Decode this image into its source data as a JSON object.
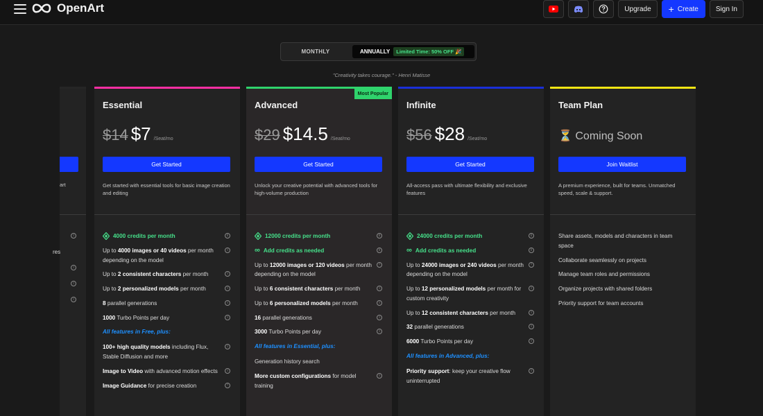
{
  "header": {
    "brand": "OpenArt",
    "buttons": {
      "upgrade": "Upgrade",
      "create": "Create",
      "signin": "Sign In"
    }
  },
  "billing": {
    "monthly": "MONTHLY",
    "annually": "ANNUALLY",
    "promo": "Limited Time: 50% OFF 🎉"
  },
  "quote": "\"Creativity takes courage.\" - Henri Matisse",
  "partial_card": {
    "desc_frag": "art",
    "feat_frag": "res"
  },
  "plans": [
    {
      "name": "Essential",
      "old_price": "$14",
      "new_price": "$7",
      "unit": "/Seat/mo",
      "cta": "Get Started",
      "accent": "#ff2fa3",
      "desc": "Get started with essential tools for basic image creation and editing",
      "credits": "4000 credits per month",
      "f1_b": "4000 images or 40 videos",
      "f1_t": "month depending on the model",
      "f2_b": "2 consistent characters",
      "f2_t": "per month",
      "f3_b": "2 personalized models",
      "f3_t": "per month",
      "f4_b": "8",
      "f4_t": "parallel generations",
      "f5_b": "1000",
      "f5_t": "Turbo Points per day",
      "section": "All features in Free, plus:",
      "e1_b": "100+ high quality models",
      "e1_t": "including Flux, Stable Diffusion and more",
      "e2_b": "Image to Video",
      "e2_t": "with advanced motion effects",
      "e3_b": "Image Guidance",
      "e3_t": "for precise creation"
    },
    {
      "name": "Advanced",
      "old_price": "$29",
      "new_price": "$14.5",
      "unit": "/Seat/mo",
      "cta": "Get Started",
      "badge": "Most Popular",
      "accent": "#2fd36c",
      "desc": "Unlock your creative potential with advanced tools for high-volume production",
      "credits": "12000 credits per month",
      "addon": "Add credits as needed",
      "f1_b": "12000 images or 120 videos",
      "f1_t": "per month depending on the model",
      "f2_b": "6 consistent characters",
      "f2_t": "per month",
      "f3_b": "6 personalized models",
      "f3_t": "per month",
      "f4_b": "16",
      "f4_t": "parallel generations",
      "f5_b": "3000",
      "f5_t": "Turbo Points per day",
      "section": "All features in Essential, plus:",
      "e1_t": "Generation history search",
      "e2_b": "More custom configurations",
      "e2_t": "for model training"
    },
    {
      "name": "Infinite",
      "old_price": "$56",
      "new_price": "$28",
      "unit": "/Seat/mo",
      "cta": "Get Started",
      "accent": "#1a2fd8",
      "desc": "All-access pass with ultimate flexibility and exclusive features",
      "credits": "24000 credits per month",
      "addon": "Add credits as needed",
      "f1_b": "24000 images or 240 videos",
      "f1_t": "per month depending on the model",
      "f2_b": "12 personalized models",
      "f2_t": "per month for custom creativity",
      "f3_b": "12 consistent characters",
      "f3_t": "per month",
      "f4_b": "32",
      "f4_t": "parallel generations",
      "f5_b": "6000",
      "f5_t": "Turbo Points per day",
      "section": "All features in Advanced, plus:",
      "e1_b": "Priority support",
      "e1_t": ": keep your creative flow uninterrupted"
    },
    {
      "name": "Team Plan",
      "soon": "⏳ Coming Soon",
      "cta": "Join Waitlist",
      "accent": "#f5e614",
      "desc": "A premium experience, built for teams. Unmatched speed, scale & support.",
      "t1": "Share assets, models and characters in team space",
      "t2": "Collaborate seamlessly on projects",
      "t3": "Manage team roles and permissions",
      "t4": "Organize projects with shared folders",
      "t5": "Priority support for team accounts"
    }
  ]
}
